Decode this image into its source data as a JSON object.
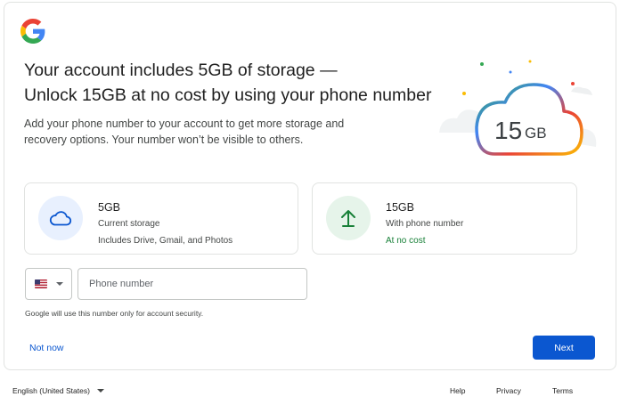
{
  "title": {
    "line1": "Your account includes 5GB of storage —",
    "line2": "Unlock 15GB at no cost by using your phone number"
  },
  "description": "Add your phone number to your account to get more storage and recovery options. Your number won’t be visible to others.",
  "hero": {
    "number": "15",
    "unit": "GB"
  },
  "options": {
    "current": {
      "icon": "cloud-icon",
      "title": "5GB",
      "subtitle": "Current storage",
      "detail": "Includes Drive, Gmail, and Photos"
    },
    "phone": {
      "icon": "arrow-up-icon",
      "title": "15GB",
      "subtitle": "With phone number",
      "detail": "At no cost"
    }
  },
  "phone_input": {
    "value": "",
    "placeholder": "Phone number",
    "country": "US"
  },
  "hint": "Google will use this number only for account security.",
  "actions": {
    "not_now": "Not now",
    "next": "Next"
  },
  "footer": {
    "language": "English (United States)",
    "help": "Help",
    "privacy": "Privacy",
    "terms": "Terms"
  },
  "colors": {
    "primary": "#0b57d0",
    "green": "#188038",
    "google_blue": "#4285f4",
    "google_red": "#ea4335",
    "google_yellow": "#fbbc04",
    "google_green": "#34a853"
  }
}
